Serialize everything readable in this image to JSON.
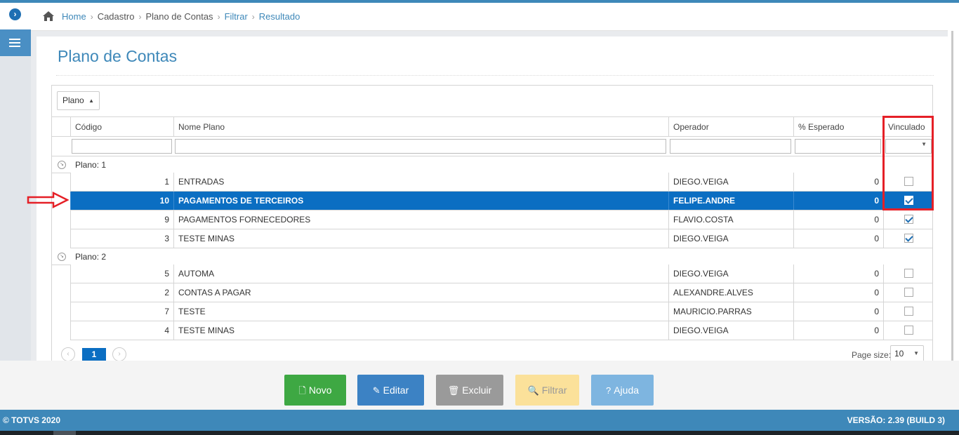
{
  "breadcrumb": {
    "items": [
      {
        "label": "Home",
        "kind": "link"
      },
      {
        "label": "Cadastro",
        "kind": "current"
      },
      {
        "label": "Plano de Contas",
        "kind": "current"
      },
      {
        "label": "Filtrar",
        "kind": "link"
      },
      {
        "label": "Resultado",
        "kind": "link"
      }
    ]
  },
  "page": {
    "title": "Plano de Contas"
  },
  "grid": {
    "group_by_label": "Plano",
    "columns": [
      "Código",
      "Nome Plano",
      "Operador",
      "% Esperado",
      "Vinculado"
    ],
    "groups": [
      {
        "label": "Plano: 1",
        "rows": [
          {
            "codigo": "1",
            "nome": "ENTRADAS",
            "operador": "DIEGO.VEIGA",
            "esperado": "0",
            "vinculado": false,
            "selected": false
          },
          {
            "codigo": "10",
            "nome": "PAGAMENTOS DE TERCEIROS",
            "operador": "FELIPE.ANDRE",
            "esperado": "0",
            "vinculado": true,
            "selected": true
          },
          {
            "codigo": "9",
            "nome": "PAGAMENTOS FORNECEDORES",
            "operador": "FLAVIO.COSTA",
            "esperado": "0",
            "vinculado": true,
            "selected": false
          },
          {
            "codigo": "3",
            "nome": "TESTE MINAS",
            "operador": "DIEGO.VEIGA",
            "esperado": "0",
            "vinculado": true,
            "selected": false
          }
        ]
      },
      {
        "label": "Plano: 2",
        "rows": [
          {
            "codigo": "5",
            "nome": "AUTOMA",
            "operador": "DIEGO.VEIGA",
            "esperado": "0",
            "vinculado": false,
            "selected": false
          },
          {
            "codigo": "2",
            "nome": "CONTAS A PAGAR",
            "operador": "ALEXANDRE.ALVES",
            "esperado": "0",
            "vinculado": false,
            "selected": false
          },
          {
            "codigo": "7",
            "nome": "TESTE",
            "operador": "MAURICIO.PARRAS",
            "esperado": "0",
            "vinculado": false,
            "selected": false
          },
          {
            "codigo": "4",
            "nome": "TESTE MINAS",
            "operador": "DIEGO.VEIGA",
            "esperado": "0",
            "vinculado": false,
            "selected": false
          }
        ]
      }
    ],
    "pager": {
      "current_page": "1",
      "page_size_label": "Page size:",
      "page_size": "10"
    }
  },
  "actions": {
    "novo": "Novo",
    "editar": "Editar",
    "excluir": "Excluir",
    "filtrar": "Filtrar",
    "ajuda": "Ajuda"
  },
  "footer": {
    "copyright": "© TOTVS 2020",
    "version": "VERSÃO: 2.39 (BUILD 3)"
  },
  "colors": {
    "accent": "#3e88b9",
    "selected_row": "#0b6ec2",
    "annotation_red": "#e52027"
  }
}
